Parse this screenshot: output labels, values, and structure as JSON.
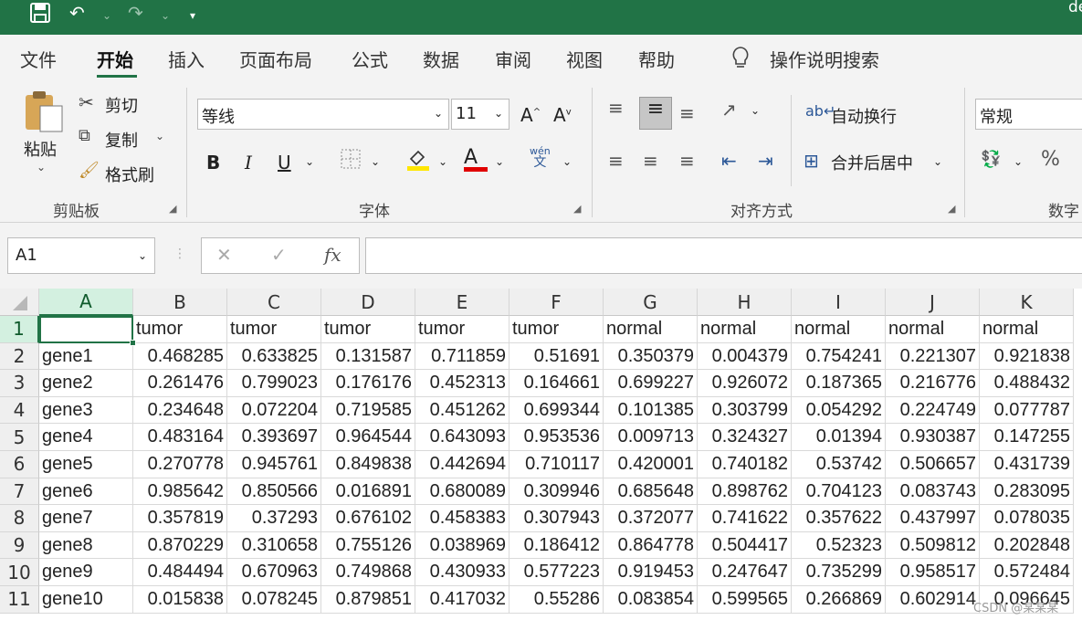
{
  "titlebar": {
    "save_icon": "save-icon",
    "undo_icon": "undo-icon",
    "redo_icon": "redo-icon",
    "customize_icon": "customize-icon",
    "doc_fragment": "de"
  },
  "tabs": [
    "文件",
    "开始",
    "插入",
    "页面布局",
    "公式",
    "数据",
    "审阅",
    "视图",
    "帮助"
  ],
  "tell_me": {
    "icon": "lightbulb-icon",
    "label": "操作说明搜索"
  },
  "clipboard": {
    "paste": "粘贴",
    "cut": "剪切",
    "copy": "复制",
    "format_painter": "格式刷",
    "group": "剪贴板"
  },
  "font": {
    "name": "等线",
    "size": "11",
    "bold": "B",
    "italic": "I",
    "underline": "U",
    "font_color": "A",
    "phonetic_top": "wén",
    "phonetic_bottom": "文",
    "group": "字体"
  },
  "alignment": {
    "wrap": "自动换行",
    "merge": "合并后居中",
    "group": "对齐方式"
  },
  "number": {
    "format": "常规",
    "percent": "%",
    "group": "数字"
  },
  "formula_bar": {
    "name_box": "A1",
    "cancel": "✕",
    "enter": "✓",
    "fx": "fx",
    "value": ""
  },
  "sheet": {
    "columns": [
      "A",
      "B",
      "C",
      "D",
      "E",
      "F",
      "G",
      "H",
      "I",
      "J",
      "K"
    ],
    "row_numbers": [
      "1",
      "2",
      "3",
      "4",
      "5",
      "6",
      "7",
      "8",
      "9",
      "10",
      "11"
    ],
    "rows": [
      [
        "",
        "tumor",
        "tumor",
        "tumor",
        "tumor",
        "tumor",
        "normal",
        "normal",
        "normal",
        "normal",
        "normal"
      ],
      [
        "gene1",
        "0.468285",
        "0.633825",
        "0.131587",
        "0.711859",
        "0.51691",
        "0.350379",
        "0.004379",
        "0.754241",
        "0.221307",
        "0.921838"
      ],
      [
        "gene2",
        "0.261476",
        "0.799023",
        "0.176176",
        "0.452313",
        "0.164661",
        "0.699227",
        "0.926072",
        "0.187365",
        "0.216776",
        "0.488432"
      ],
      [
        "gene3",
        "0.234648",
        "0.072204",
        "0.719585",
        "0.451262",
        "0.699344",
        "0.101385",
        "0.303799",
        "0.054292",
        "0.224749",
        "0.077787"
      ],
      [
        "gene4",
        "0.483164",
        "0.393697",
        "0.964544",
        "0.643093",
        "0.953536",
        "0.009713",
        "0.324327",
        "0.01394",
        "0.930387",
        "0.147255"
      ],
      [
        "gene5",
        "0.270778",
        "0.945761",
        "0.849838",
        "0.442694",
        "0.710117",
        "0.420001",
        "0.740182",
        "0.53742",
        "0.506657",
        "0.431739"
      ],
      [
        "gene6",
        "0.985642",
        "0.850566",
        "0.016891",
        "0.680089",
        "0.309946",
        "0.685648",
        "0.898762",
        "0.704123",
        "0.083743",
        "0.283095"
      ],
      [
        "gene7",
        "0.357819",
        "0.37293",
        "0.676102",
        "0.458383",
        "0.307943",
        "0.372077",
        "0.741622",
        "0.357622",
        "0.437997",
        "0.078035"
      ],
      [
        "gene8",
        "0.870229",
        "0.310658",
        "0.755126",
        "0.038969",
        "0.186412",
        "0.864778",
        "0.504417",
        "0.52323",
        "0.509812",
        "0.202848"
      ],
      [
        "gene9",
        "0.484494",
        "0.670963",
        "0.749868",
        "0.430933",
        "0.577223",
        "0.919453",
        "0.247647",
        "0.735299",
        "0.958517",
        "0.572484"
      ],
      [
        "gene10",
        "0.015838",
        "0.078245",
        "0.879851",
        "0.417032",
        "0.55286",
        "0.083854",
        "0.599565",
        "0.266869",
        "0.602914",
        "0.096645"
      ]
    ]
  },
  "watermark": "CSDN @某某某",
  "colors": {
    "accent": "#217346",
    "selected_header": "#d3f0e0",
    "highlight": "#ffe600",
    "font_color": "#e00000"
  }
}
